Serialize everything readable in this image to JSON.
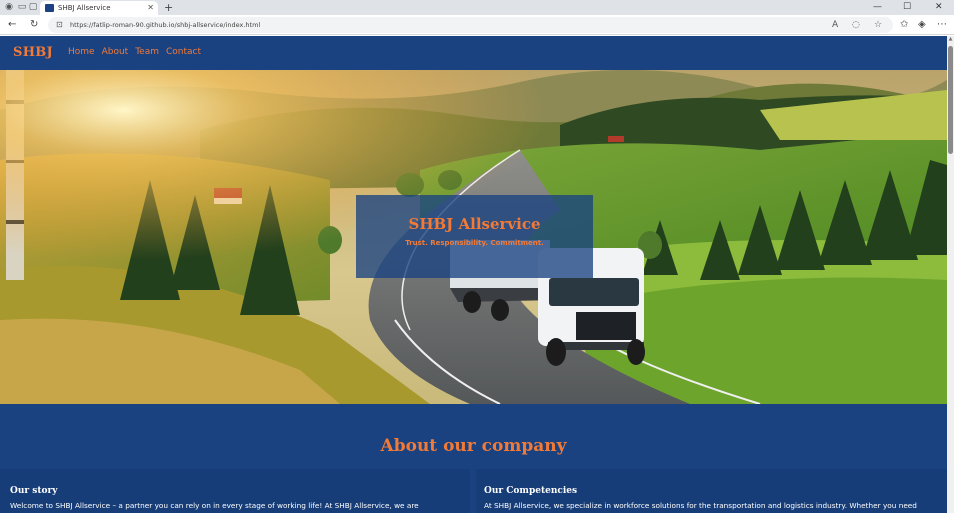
{
  "browser": {
    "tab_title": "SHBJ Allservice",
    "url": "https://fatlip-roman-90.github.io/shbj-allservice/index.html",
    "icons": [
      "profile-icon",
      "workspaces-icon",
      "tab-actions-icon",
      "close-icon",
      "new-tab-icon",
      "minimize-icon",
      "maximize-icon",
      "back-icon",
      "refresh-icon",
      "site-info-icon",
      "read-aloud-icon",
      "tracking-icon",
      "favorite-icon",
      "favorites-bar-icon",
      "copilot-icon",
      "more-icon"
    ]
  },
  "site": {
    "logo": "SHBJ",
    "nav": [
      "Home",
      "About",
      "Team",
      "Contact"
    ]
  },
  "hero": {
    "title": "SHBJ Allservice",
    "tagline": "Trust. Responsibility. Commitment."
  },
  "about": {
    "title": "About our company",
    "story_heading": "Our story",
    "story_text": "Welcome to SHBJ Allservice – a partner you can rely on in every stage of working life! At SHBJ Allservice, we are",
    "competencies_heading": "Our Competencies",
    "competencies_text": "At SHBJ Allservice, we specialize in workforce solutions for the transportation and logistics industry. Whether you need"
  },
  "colors": {
    "brand_navy": "#1a4281",
    "accent_orange": "#f27a36"
  }
}
